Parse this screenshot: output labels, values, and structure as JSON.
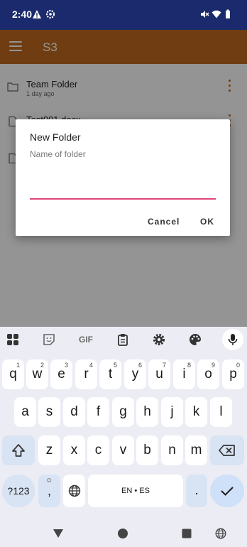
{
  "status_bar": {
    "time": "2:40",
    "icons": [
      "alert-icon",
      "settings-icon",
      "mute-icon",
      "wifi-icon",
      "battery-icon"
    ]
  },
  "app_bar": {
    "title": "S3",
    "menu_icon": "hamburger-menu-icon"
  },
  "files": [
    {
      "name": "Team Folder",
      "sub": "1 day ago",
      "icon": "folder-icon"
    },
    {
      "name": "Test001.docx",
      "sub": "",
      "icon": "file-icon"
    },
    {
      "name": "",
      "sub": "",
      "icon": "file-icon"
    }
  ],
  "dialog": {
    "title": "New Folder",
    "input_placeholder": "Name of folder",
    "input_value": "",
    "cancel_label": "Cancel",
    "ok_label": "OK"
  },
  "keyboard": {
    "toolbar": [
      "apps-icon",
      "sticker-icon",
      "gif-icon",
      "clipboard-icon",
      "settings-icon",
      "palette-icon",
      "mic-icon"
    ],
    "gif_label": "GIF",
    "row1": [
      {
        "k": "q",
        "h": "1"
      },
      {
        "k": "w",
        "h": "2"
      },
      {
        "k": "e",
        "h": "3"
      },
      {
        "k": "r",
        "h": "4"
      },
      {
        "k": "t",
        "h": "5"
      },
      {
        "k": "y",
        "h": "6"
      },
      {
        "k": "u",
        "h": "7"
      },
      {
        "k": "i",
        "h": "8"
      },
      {
        "k": "o",
        "h": "9"
      },
      {
        "k": "p",
        "h": "0"
      }
    ],
    "row2": [
      "a",
      "s",
      "d",
      "f",
      "g",
      "h",
      "j",
      "k",
      "l"
    ],
    "row3": [
      "z",
      "x",
      "c",
      "v",
      "b",
      "n",
      "m"
    ],
    "sym_label": "?123",
    "comma_label": ",",
    "emoji_hint": "☺",
    "space_label": "EN • ES",
    "period_label": "."
  },
  "colors": {
    "status_bar": "#1a2a6c",
    "app_bar": "#bf6a1e",
    "input_underline": "#e0457b",
    "keyboard_bg": "#ecedf4"
  }
}
